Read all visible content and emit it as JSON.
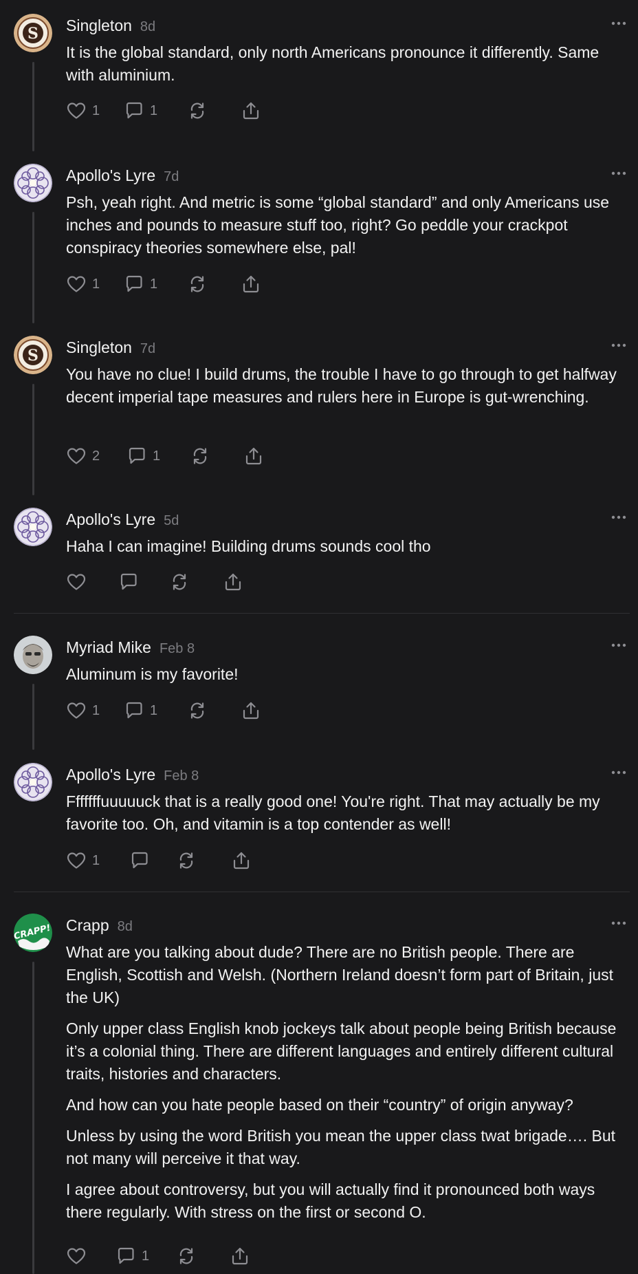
{
  "posts": [
    {
      "author": "Singleton",
      "time": "8d",
      "avatar": "s-logo-avatar",
      "paragraphs": [
        "It is the global standard, only north Americans pronounce it differently. Same with aluminium."
      ],
      "likes": "1",
      "replies": "1"
    },
    {
      "author": "Apollo's Lyre",
      "time": "7d",
      "avatar": "mandala-avatar",
      "paragraphs": [
        "Psh, yeah right. And metric is some “global standard” and only Americans use inches and pounds to measure stuff too, right? Go peddle your crackpot conspiracy theories somewhere else, pal!"
      ],
      "likes": "1",
      "replies": "1"
    },
    {
      "author": "Singleton",
      "time": "7d",
      "avatar": "s-logo-avatar",
      "paragraphs": [
        "You have no clue! I build drums, the trouble I have to go through to get halfway decent imperial tape measures and rulers here in Europe is gut-wrenching."
      ],
      "likes": "2",
      "replies": "1"
    },
    {
      "author": "Apollo's Lyre",
      "time": "5d",
      "avatar": "mandala-avatar",
      "paragraphs": [
        "Haha I can imagine! Building drums sounds cool tho"
      ],
      "likes": "",
      "replies": ""
    },
    {
      "author": "Myriad Mike",
      "time": "Feb 8",
      "avatar": "face-avatar",
      "paragraphs": [
        "Aluminum is my favorite!"
      ],
      "likes": "1",
      "replies": "1"
    },
    {
      "author": "Apollo's Lyre",
      "time": "Feb 8",
      "avatar": "mandala-avatar",
      "paragraphs": [
        "Fffffffuuuuuck that is a really good one! You're right. That may actually be my favorite too. Oh, and vitamin is a top contender as well!"
      ],
      "likes": "1",
      "replies": ""
    },
    {
      "author": "Crapp",
      "time": "8d",
      "avatar": "crapp-logo-avatar",
      "avatar_text": "CRAPP!",
      "paragraphs": [
        "What are you talking about dude? There are no British people. There are English, Scottish and Welsh. (Northern Ireland doesn’t form part of Britain, just the UK)",
        "Only upper class English knob jockeys talk about people being British because it’s a colonial thing. There are different languages and entirely different cultural traits, histories and characters.",
        "And how can you hate people based on their “country” of origin anyway?",
        "Unless by using the word British you mean the upper class twat brigade…. But not many will perceive it that way.",
        "I agree about controversy, but you will actually find it pronounced both ways there regularly. With stress on the first or second O."
      ],
      "likes": "",
      "replies": "1"
    }
  ],
  "colors": {
    "background": "#19191b",
    "text": "#f2f2f2",
    "muted": "#7c7c80",
    "icon": "#8e8e93",
    "thread_line": "#3a3a3d",
    "crapp_green": "#1f8f4a"
  }
}
